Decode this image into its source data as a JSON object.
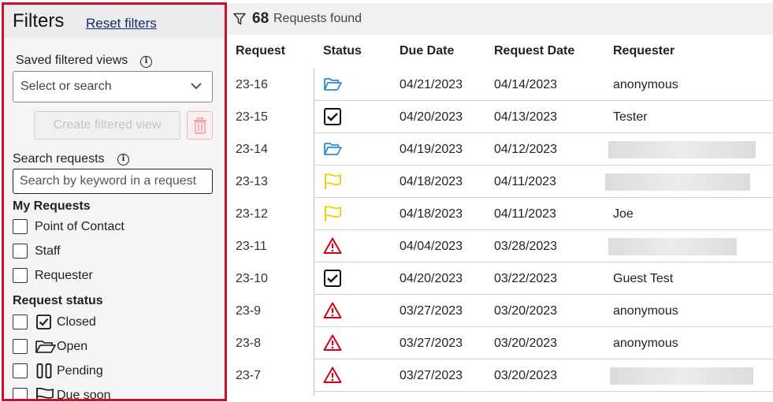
{
  "filters": {
    "title": "Filters",
    "reset_label": "Reset filters",
    "saved_views_label": "Saved filtered views",
    "saved_views_placeholder": "Select or search",
    "create_view_label": "Create filtered view",
    "search_label": "Search requests",
    "search_placeholder": "Search by keyword in a request",
    "my_requests_heading": "My Requests",
    "my_requests": [
      {
        "label": "Point of Contact",
        "checked": false
      },
      {
        "label": "Staff",
        "checked": false
      },
      {
        "label": "Requester",
        "checked": false
      }
    ],
    "status_heading": "Request status",
    "statuses": [
      {
        "label": "Closed",
        "icon": "checkbox-checked-icon",
        "checked": false
      },
      {
        "label": "Open",
        "icon": "folder-open-icon",
        "checked": false
      },
      {
        "label": "Pending",
        "icon": "pause-icon",
        "checked": false
      },
      {
        "label": "Due soon",
        "icon": "flag-icon",
        "checked": false
      }
    ]
  },
  "results": {
    "count": "68",
    "found_label": "Requests found",
    "columns": [
      "Request",
      "Status",
      "Due Date",
      "Request Date",
      "Requester"
    ],
    "rows": [
      {
        "id": "23-16",
        "status": "open",
        "due": "04/21/2023",
        "requested": "04/14/2023",
        "requester": "anonymous"
      },
      {
        "id": "23-15",
        "status": "closed",
        "due": "04/20/2023",
        "requested": "04/13/2023",
        "requester": "Tester"
      },
      {
        "id": "23-14",
        "status": "open",
        "due": "04/19/2023",
        "requested": "04/12/2023",
        "requester": ""
      },
      {
        "id": "23-13",
        "status": "due-soon",
        "due": "04/18/2023",
        "requested": "04/11/2023",
        "requester": ""
      },
      {
        "id": "23-12",
        "status": "due-soon",
        "due": "04/18/2023",
        "requested": "04/11/2023",
        "requester": "Joe"
      },
      {
        "id": "23-11",
        "status": "overdue",
        "due": "04/04/2023",
        "requested": "03/28/2023",
        "requester": ""
      },
      {
        "id": "23-10",
        "status": "closed",
        "due": "04/20/2023",
        "requested": "03/22/2023",
        "requester": "Guest Test"
      },
      {
        "id": "23-9",
        "status": "overdue",
        "due": "03/27/2023",
        "requested": "03/20/2023",
        "requester": "anonymous"
      },
      {
        "id": "23-8",
        "status": "overdue",
        "due": "03/27/2023",
        "requested": "03/20/2023",
        "requester": "anonymous"
      },
      {
        "id": "23-7",
        "status": "overdue",
        "due": "03/27/2023",
        "requested": "03/20/2023",
        "requester": ""
      }
    ]
  },
  "colors": {
    "panel_border": "#c8102e",
    "link": "#1b2a6b",
    "status_open": "#2a8fd6",
    "status_due_soon": "#e8d400",
    "status_overdue": "#d0021b",
    "status_closed": "#111111"
  }
}
